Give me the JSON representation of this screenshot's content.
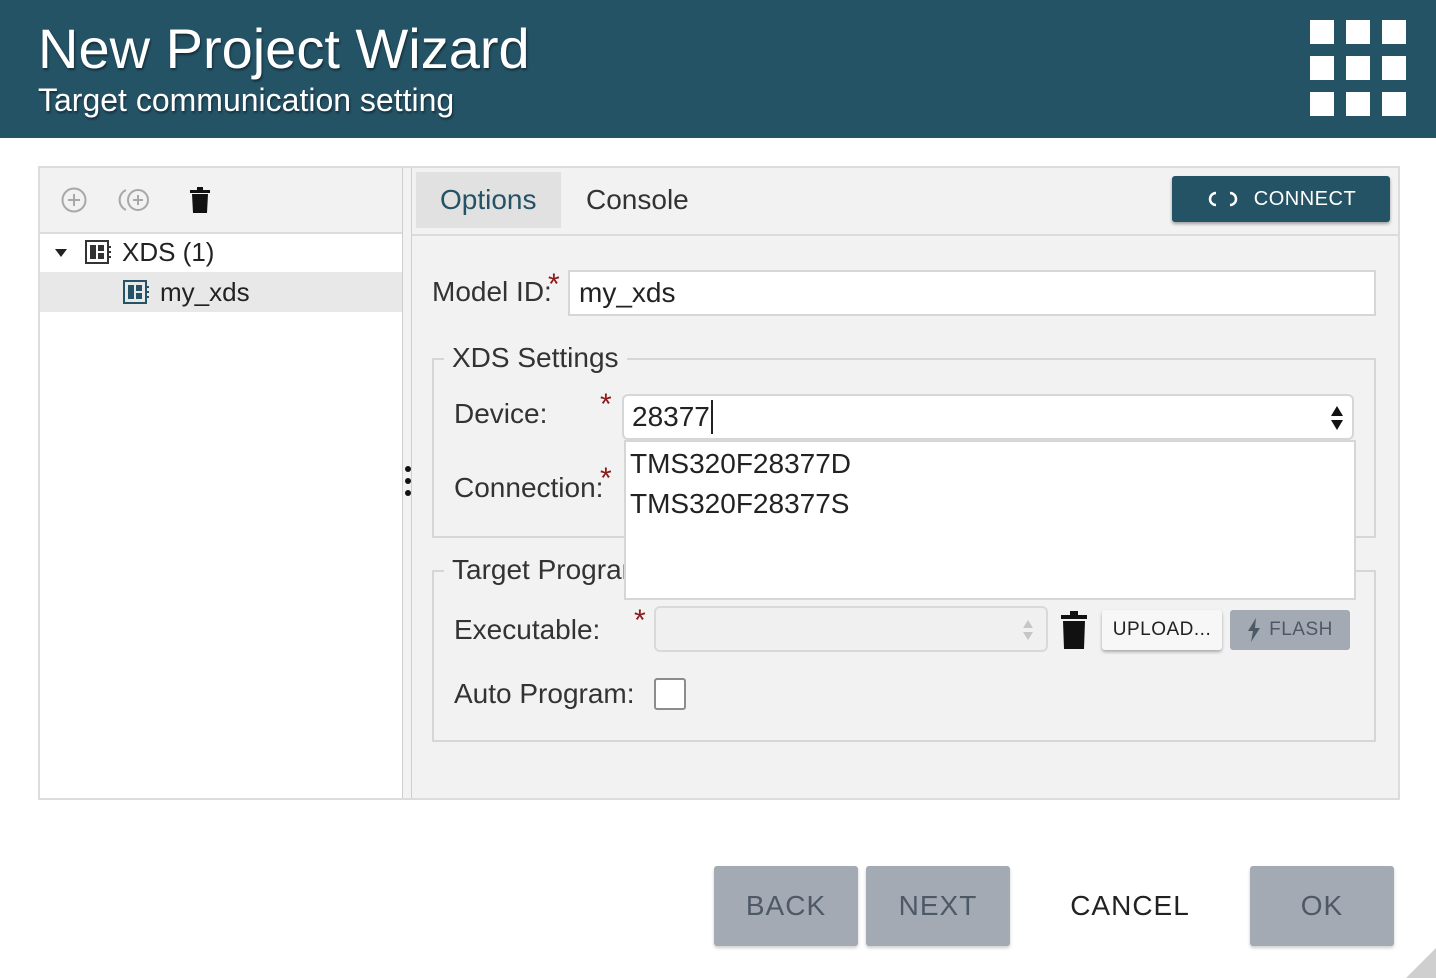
{
  "header": {
    "title": "New Project Wizard",
    "subtitle": "Target communication setting",
    "menu_icon": "apps-grid-icon",
    "background_color": "#245366"
  },
  "left_panel": {
    "toolbar": {
      "add_icon": "add-circle-icon",
      "add_child_icon": "add-child-icon",
      "delete_icon": "trash-icon"
    },
    "tree": [
      {
        "label": "XDS (1)",
        "expanded": true,
        "icon": "board-icon"
      },
      {
        "label": "my_xds",
        "selected": true,
        "icon": "board-icon"
      }
    ]
  },
  "right_panel": {
    "tabs": [
      {
        "label": "Options",
        "active": true
      },
      {
        "label": "Console",
        "active": false
      }
    ],
    "connect_button": {
      "label": "CONNECT",
      "icon": "connect-icon"
    },
    "model_id": {
      "label": "Model ID:",
      "value": "my_xds",
      "required": "*"
    },
    "xds_settings": {
      "legend": "XDS Settings",
      "device": {
        "label": "Device:",
        "value": "28377",
        "required": "*",
        "options": [
          "TMS320F28377D",
          "TMS320F28377S"
        ]
      },
      "connection": {
        "label": "Connection:",
        "required": "*"
      }
    },
    "target_programming": {
      "legend": "Target Program",
      "executable": {
        "label": "Executable:",
        "value": "",
        "required": "*"
      },
      "upload_label": "UPLOAD...",
      "flash_label": "FLASH",
      "auto_program": {
        "label": "Auto Program:",
        "checked": false
      }
    }
  },
  "footer": {
    "back": "BACK",
    "next": "NEXT",
    "cancel": "CANCEL",
    "ok": "OK"
  },
  "colors": {
    "accent": "#245366",
    "required": "#8b1a1a",
    "disabled_button": "#a3aab3"
  }
}
